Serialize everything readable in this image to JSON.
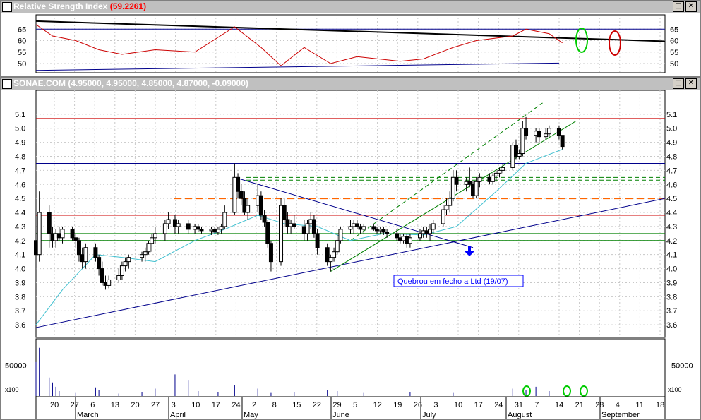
{
  "rsi_panel": {
    "title": "Relative Strength Index",
    "value": "(59.2261)",
    "axis_ticks": [
      65,
      60,
      55,
      50
    ]
  },
  "price_panel": {
    "title": "SONAE.COM",
    "ohlc": "(4.95000, 4.95000, 4.85000, 4.87000, -0.09000)",
    "axis_ticks": [
      5.1,
      5.0,
      4.9,
      4.8,
      4.7,
      4.6,
      4.5,
      4.4,
      4.3,
      4.2,
      4.1,
      4.0,
      3.9,
      3.8,
      3.7,
      3.6
    ],
    "annotation": "Quebrou em fecho a Ltd (19/07)"
  },
  "volume_panel": {
    "axis_tick": "50000",
    "multiplier": "x100"
  },
  "window_buttons": {
    "maximize": "□",
    "close": "✕"
  },
  "x_axis": {
    "day_labels": [
      "20",
      "27",
      "6",
      "13",
      "20",
      "27",
      "3",
      "10",
      "17",
      "24",
      "2",
      "8",
      "15",
      "22",
      "29",
      "5",
      "12",
      "19",
      "26",
      "3",
      "10",
      "17",
      "24",
      "31",
      "7",
      "14",
      "21",
      "28",
      "4",
      "11",
      "18"
    ],
    "month_labels": [
      "March",
      "April",
      "May",
      "June",
      "July",
      "August",
      "September"
    ]
  },
  "colors": {
    "rsi_line": "#cc0000",
    "candles": "#000000",
    "moving_average": "#40c0d0",
    "trendline": "#00008b",
    "resistance": "#cc0000",
    "support_dashed": "#ff6600",
    "channel": "#008000",
    "volume": "#00008b",
    "highlight_green": "#00cc00",
    "highlight_red": "#cc0000"
  },
  "chart_data": {
    "type": "candlestick",
    "x_start": "2001-03-15",
    "x_end": "2001-09-21",
    "ohlc": [
      [
        "2001-03-15",
        4.2,
        4.35,
        4.0,
        4.1
      ],
      [
        "2001-03-16",
        4.1,
        4.55,
        4.05,
        4.4
      ],
      [
        "2001-03-19",
        4.4,
        4.45,
        4.15,
        4.25
      ],
      [
        "2001-03-20",
        4.25,
        4.3,
        4.15,
        4.2
      ],
      [
        "2001-03-21",
        4.2,
        4.28,
        4.15,
        4.25
      ],
      [
        "2001-03-22",
        4.25,
        4.3,
        4.2,
        4.22
      ],
      [
        "2001-03-23",
        4.22,
        4.3,
        4.18,
        4.28
      ],
      [
        "2001-03-26",
        4.28,
        4.3,
        4.2,
        4.22
      ],
      [
        "2001-03-27",
        4.22,
        4.25,
        4.15,
        4.2
      ],
      [
        "2001-03-28",
        4.2,
        4.22,
        4.05,
        4.1
      ],
      [
        "2001-03-29",
        4.1,
        4.15,
        4.0,
        4.05
      ],
      [
        "2001-03-30",
        4.05,
        4.18,
        4.0,
        4.15
      ],
      [
        "2001-04-02",
        4.15,
        4.18,
        4.05,
        4.08
      ],
      [
        "2001-04-03",
        4.08,
        4.1,
        3.95,
        4.0
      ],
      [
        "2001-04-04",
        4.0,
        4.05,
        3.88,
        3.9
      ],
      [
        "2001-04-05",
        3.9,
        3.95,
        3.85,
        3.88
      ],
      [
        "2001-04-06",
        3.88,
        3.95,
        3.86,
        3.92
      ],
      [
        "2001-04-09",
        3.92,
        4.0,
        3.9,
        3.95
      ],
      [
        "2001-04-10",
        3.95,
        4.05,
        3.92,
        4.02
      ],
      [
        "2001-04-11",
        4.02,
        4.08,
        3.98,
        4.05
      ],
      [
        "2001-04-12",
        4.05,
        4.1,
        4.0,
        4.08
      ],
      [
        "2001-04-16",
        4.08,
        4.12,
        4.05,
        4.1
      ],
      [
        "2001-04-17",
        4.1,
        4.15,
        4.05,
        4.12
      ],
      [
        "2001-04-18",
        4.12,
        4.2,
        4.1,
        4.18
      ],
      [
        "2001-04-19",
        4.18,
        4.25,
        4.12,
        4.22
      ],
      [
        "2001-04-20",
        4.22,
        4.3,
        4.18,
        4.25
      ],
      [
        "2001-04-23",
        4.25,
        4.35,
        4.2,
        4.32
      ],
      [
        "2001-04-24",
        4.32,
        4.4,
        4.28,
        4.35
      ],
      [
        "2001-04-26",
        4.35,
        4.38,
        4.25,
        4.3
      ],
      [
        "2001-04-27",
        4.3,
        4.35,
        4.25,
        4.32
      ],
      [
        "2001-04-30",
        4.32,
        4.35,
        4.25,
        4.28
      ],
      [
        "2001-05-02",
        4.28,
        4.32,
        4.25,
        4.3
      ],
      [
        "2001-05-03",
        4.3,
        4.32,
        4.26,
        4.28
      ],
      [
        "2001-05-04",
        4.28,
        4.3,
        4.25,
        4.27
      ],
      [
        "2001-05-07",
        4.27,
        4.3,
        4.24,
        4.28
      ],
      [
        "2001-05-08",
        4.28,
        4.3,
        4.25,
        4.26
      ],
      [
        "2001-05-09",
        4.26,
        4.3,
        4.24,
        4.28
      ],
      [
        "2001-05-10",
        4.28,
        4.32,
        4.25,
        4.3
      ],
      [
        "2001-05-11",
        4.3,
        4.45,
        4.28,
        4.4
      ],
      [
        "2001-05-14",
        4.4,
        4.75,
        4.38,
        4.65
      ],
      [
        "2001-05-15",
        4.65,
        4.68,
        4.5,
        4.55
      ],
      [
        "2001-05-16",
        4.55,
        4.6,
        4.45,
        4.5
      ],
      [
        "2001-05-17",
        4.5,
        4.55,
        4.38,
        4.4
      ],
      [
        "2001-05-18",
        4.4,
        4.5,
        4.35,
        4.45
      ],
      [
        "2001-05-21",
        4.45,
        4.6,
        4.4,
        4.52
      ],
      [
        "2001-05-22",
        4.52,
        4.55,
        4.35,
        4.38
      ],
      [
        "2001-05-23",
        4.38,
        4.42,
        4.3,
        4.33
      ],
      [
        "2001-05-24",
        4.33,
        4.35,
        4.15,
        4.18
      ],
      [
        "2001-05-25",
        4.18,
        4.2,
        3.98,
        4.05
      ],
      [
        "2001-05-28",
        4.05,
        4.5,
        4.02,
        4.45
      ],
      [
        "2001-05-29",
        4.45,
        4.5,
        4.3,
        4.35
      ],
      [
        "2001-05-30",
        4.35,
        4.4,
        4.25,
        4.3
      ],
      [
        "2001-05-31",
        4.3,
        4.35,
        4.25,
        4.32
      ],
      [
        "2001-06-01",
        4.32,
        4.38,
        4.28,
        4.3
      ],
      [
        "2001-06-04",
        4.3,
        4.35,
        4.2,
        4.25
      ],
      [
        "2001-06-05",
        4.25,
        4.35,
        4.2,
        4.32
      ],
      [
        "2001-06-06",
        4.32,
        4.4,
        4.28,
        4.35
      ],
      [
        "2001-06-07",
        4.35,
        4.38,
        4.22,
        4.25
      ],
      [
        "2001-06-08",
        4.25,
        4.28,
        4.1,
        4.15
      ],
      [
        "2001-06-11",
        4.15,
        4.18,
        4.02,
        4.05
      ],
      [
        "2001-06-12",
        4.05,
        4.1,
        3.98,
        4.08
      ],
      [
        "2001-06-13",
        4.08,
        4.15,
        4.05,
        4.12
      ],
      [
        "2001-06-14",
        4.12,
        4.25,
        4.1,
        4.2
      ],
      [
        "2001-06-15",
        4.2,
        4.3,
        4.18,
        4.28
      ],
      [
        "2001-06-18",
        4.28,
        4.35,
        4.25,
        4.3
      ],
      [
        "2001-06-19",
        4.3,
        4.35,
        4.25,
        4.32
      ],
      [
        "2001-06-20",
        4.32,
        4.35,
        4.28,
        4.3
      ],
      [
        "2001-06-21",
        4.3,
        4.32,
        4.25,
        4.28
      ],
      [
        "2001-06-22",
        4.28,
        4.32,
        4.25,
        4.3
      ],
      [
        "2001-06-25",
        4.3,
        4.32,
        4.27,
        4.28
      ],
      [
        "2001-06-26",
        4.28,
        4.3,
        4.25,
        4.27
      ],
      [
        "2001-06-27",
        4.27,
        4.3,
        4.25,
        4.28
      ],
      [
        "2001-06-28",
        4.28,
        4.3,
        4.24,
        4.26
      ],
      [
        "2001-06-29",
        4.26,
        4.28,
        4.22,
        4.25
      ],
      [
        "2001-07-02",
        4.25,
        4.28,
        4.2,
        4.22
      ],
      [
        "2001-07-03",
        4.22,
        4.25,
        4.18,
        4.2
      ],
      [
        "2001-07-04",
        4.2,
        4.25,
        4.18,
        4.23
      ],
      [
        "2001-07-05",
        4.23,
        4.25,
        4.15,
        4.18
      ],
      [
        "2001-07-06",
        4.18,
        4.25,
        4.15,
        4.22
      ],
      [
        "2001-07-09",
        4.22,
        4.28,
        4.2,
        4.25
      ],
      [
        "2001-07-10",
        4.25,
        4.3,
        4.22,
        4.27
      ],
      [
        "2001-07-11",
        4.27,
        4.3,
        4.22,
        4.25
      ],
      [
        "2001-07-12",
        4.25,
        4.32,
        4.2,
        4.28
      ],
      [
        "2001-07-13",
        4.28,
        4.35,
        4.25,
        4.32
      ],
      [
        "2001-07-16",
        4.32,
        4.45,
        4.3,
        4.42
      ],
      [
        "2001-07-17",
        4.42,
        4.5,
        4.38,
        4.45
      ],
      [
        "2001-07-18",
        4.45,
        4.55,
        4.4,
        4.5
      ],
      [
        "2001-07-19",
        4.5,
        4.7,
        4.48,
        4.65
      ],
      [
        "2001-07-20",
        4.65,
        4.7,
        4.55,
        4.6
      ],
      [
        "2001-07-23",
        4.6,
        4.65,
        4.55,
        4.62
      ],
      [
        "2001-07-24",
        4.62,
        4.72,
        4.58,
        4.6
      ],
      [
        "2001-07-25",
        4.6,
        4.62,
        4.5,
        4.52
      ],
      [
        "2001-07-26",
        4.52,
        4.65,
        4.5,
        4.62
      ],
      [
        "2001-07-27",
        4.62,
        4.68,
        4.58,
        4.65
      ],
      [
        "2001-07-30",
        4.65,
        4.68,
        4.6,
        4.62
      ],
      [
        "2001-07-31",
        4.62,
        4.68,
        4.6,
        4.66
      ],
      [
        "2001-08-01",
        4.66,
        4.7,
        4.62,
        4.68
      ],
      [
        "2001-08-02",
        4.68,
        4.72,
        4.65,
        4.7
      ],
      [
        "2001-08-03",
        4.7,
        4.75,
        4.68,
        4.72
      ],
      [
        "2001-08-06",
        4.72,
        4.9,
        4.7,
        4.88
      ],
      [
        "2001-08-07",
        4.88,
        4.92,
        4.78,
        4.8
      ],
      [
        "2001-08-08",
        4.8,
        4.85,
        4.78,
        4.82
      ],
      [
        "2001-08-09",
        4.82,
        5.05,
        4.8,
        5.0
      ],
      [
        "2001-08-10",
        5.0,
        5.08,
        4.92,
        4.95
      ],
      [
        "2001-08-13",
        4.95,
        5.0,
        4.9,
        4.98
      ],
      [
        "2001-08-14",
        4.98,
        5.0,
        4.9,
        4.94
      ],
      [
        "2001-08-16",
        4.94,
        5.0,
        4.92,
        4.96
      ],
      [
        "2001-08-17",
        4.96,
        5.02,
        4.94,
        5.0
      ],
      [
        "2001-08-20",
        5.0,
        5.02,
        4.92,
        4.95
      ],
      [
        "2001-08-21",
        4.95,
        4.95,
        4.85,
        4.87
      ]
    ],
    "ylim": [
      3.52,
      5.22
    ],
    "moving_average": [
      [
        "2001-03-15",
        3.6
      ],
      [
        "2001-03-23",
        3.85
      ],
      [
        "2001-04-02",
        4.1
      ],
      [
        "2001-04-10",
        4.08
      ],
      [
        "2001-04-20",
        4.05
      ],
      [
        "2001-05-02",
        4.2
      ],
      [
        "2001-05-11",
        4.28
      ],
      [
        "2001-05-21",
        4.38
      ],
      [
        "2001-05-29",
        4.32
      ],
      [
        "2001-06-08",
        4.3
      ],
      [
        "2001-06-18",
        4.2
      ],
      [
        "2001-06-28",
        4.25
      ],
      [
        "2001-07-10",
        4.24
      ],
      [
        "2001-07-20",
        4.3
      ],
      [
        "2001-08-01",
        4.55
      ],
      [
        "2001-08-10",
        4.75
      ],
      [
        "2001-08-21",
        4.85
      ]
    ],
    "resistance_lines": [
      5.07,
      4.75,
      4.38
    ],
    "support_lines": [
      4.25,
      4.2
    ],
    "dashed_resistance_orange": 4.5,
    "dashed_lines_green": [
      4.65,
      4.63
    ],
    "trendlines": [
      {
        "name": "long-term support",
        "points": [
          [
            "2001-03-15",
            3.58
          ],
          [
            "2001-09-21",
            4.5
          ]
        ]
      },
      {
        "name": "descending resistance",
        "points": [
          [
            "2001-05-14",
            4.65
          ],
          [
            "2001-07-25",
            4.15
          ]
        ]
      },
      {
        "name": "channel lower",
        "points": [
          [
            "2001-06-12",
            3.98
          ],
          [
            "2001-08-25",
            5.05
          ]
        ]
      },
      {
        "name": "channel upper",
        "points": [
          [
            "2001-06-18",
            4.2
          ],
          [
            "2001-08-15",
            5.18
          ]
        ]
      }
    ],
    "rsi": {
      "ylim": [
        46,
        70
      ],
      "values": [
        [
          "2001-03-15",
          67
        ],
        [
          "2001-03-20",
          62
        ],
        [
          "2001-03-27",
          60
        ],
        [
          "2001-04-03",
          56
        ],
        [
          "2001-04-10",
          54
        ],
        [
          "2001-04-20",
          56
        ],
        [
          "2001-05-02",
          55
        ],
        [
          "2001-05-14",
          66
        ],
        [
          "2001-05-22",
          57
        ],
        [
          "2001-05-28",
          49
        ],
        [
          "2001-06-04",
          57
        ],
        [
          "2001-06-12",
          50
        ],
        [
          "2001-06-20",
          53
        ],
        [
          "2001-07-03",
          51
        ],
        [
          "2001-07-10",
          52
        ],
        [
          "2001-07-19",
          57
        ],
        [
          "2001-07-26",
          60
        ],
        [
          "2001-08-06",
          62
        ],
        [
          "2001-08-10",
          65
        ],
        [
          "2001-08-17",
          63
        ],
        [
          "2001-08-21",
          59
        ]
      ],
      "trend_upper": [
        [
          "2001-03-15",
          68.5
        ],
        [
          "2001-09-21",
          59.7
        ]
      ],
      "trend_lower": [
        [
          "2001-03-15",
          47
        ],
        [
          "2001-08-20",
          50.2
        ]
      ],
      "reference_line": 65
    },
    "volume": {
      "ylim": [
        0,
        80000
      ],
      "values": [
        [
          "2001-03-15",
          55000
        ],
        [
          "2001-03-16",
          78000
        ],
        [
          "2001-03-19",
          30000
        ],
        [
          "2001-03-20",
          22000
        ],
        [
          "2001-03-21",
          15000
        ],
        [
          "2001-03-22",
          8000
        ],
        [
          "2001-03-27",
          5000
        ],
        [
          "2001-04-02",
          14000
        ],
        [
          "2001-04-03",
          10000
        ],
        [
          "2001-04-09",
          4000
        ],
        [
          "2001-04-16",
          6000
        ],
        [
          "2001-04-20",
          12000
        ],
        [
          "2001-04-26",
          35000
        ],
        [
          "2001-04-30",
          25000
        ],
        [
          "2001-05-03",
          8000
        ],
        [
          "2001-05-09",
          6000
        ],
        [
          "2001-05-14",
          18000
        ],
        [
          "2001-05-21",
          12000
        ],
        [
          "2001-05-25",
          5000
        ],
        [
          "2001-06-01",
          6000
        ],
        [
          "2001-06-11",
          10000
        ],
        [
          "2001-06-14",
          8000
        ],
        [
          "2001-06-22",
          5000
        ],
        [
          "2001-07-06",
          6000
        ],
        [
          "2001-07-19",
          5000
        ],
        [
          "2001-08-06",
          12000
        ],
        [
          "2001-08-10",
          10000
        ],
        [
          "2001-08-13",
          15000
        ],
        [
          "2001-08-17",
          8000
        ]
      ]
    }
  }
}
